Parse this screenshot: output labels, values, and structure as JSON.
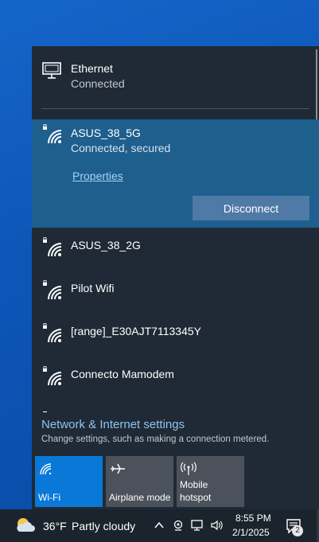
{
  "ethernet": {
    "name": "Ethernet",
    "status": "Connected"
  },
  "connected_network": {
    "ssid": "ASUS_38_5G",
    "status": "Connected, secured",
    "properties_label": "Properties",
    "disconnect_label": "Disconnect"
  },
  "networks": [
    {
      "ssid": "ASUS_38_2G"
    },
    {
      "ssid": "Pilot Wifi"
    },
    {
      "ssid": "[range]_E30AJT7113345Y"
    },
    {
      "ssid": "Connecto Mamodem"
    }
  ],
  "settings": {
    "link": "Network & Internet settings",
    "description": "Change settings, such as making a connection metered."
  },
  "quick_actions": [
    {
      "label": "Wi-Fi",
      "icon": "wifi-icon",
      "active": true
    },
    {
      "label": "Airplane mode",
      "icon": "airplane-icon",
      "active": false
    },
    {
      "label": "Mobile\nhotspot",
      "icon": "hotspot-icon",
      "active": false
    }
  ],
  "taskbar": {
    "temperature": "36°F",
    "condition": "Partly cloudy",
    "time": "8:55 PM",
    "date": "2/1/2025",
    "notification_count": "2"
  },
  "colors": {
    "accent": "#0a78d7",
    "selected_row": "#1e5f8e",
    "flyout_bg": "#1f2a36",
    "link": "#8fc4f0"
  }
}
